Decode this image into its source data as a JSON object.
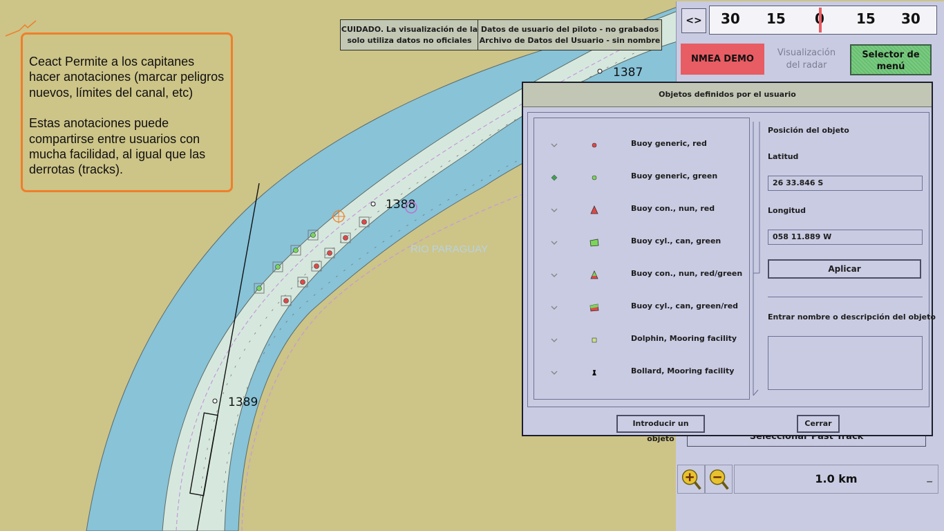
{
  "colors": {
    "land": "#cdc488",
    "deep_water": "#88c3d8",
    "shallow_water": "#d6e8de",
    "callout_border": "#ef7f2a",
    "panel_bg": "#c9cbe2",
    "nmea_bg": "#e85c63",
    "menu_bg": "#66c06f"
  },
  "callout": {
    "paragraph1": "Ceact Permite a los capitanes hacer anotaciones (marcar peligros nuevos, límites del canal, etc)",
    "paragraph2": "Estas anotaciones puede compartirse entre usuarios con mucha facilidad, al igual que las derrotas (tracks)."
  },
  "map": {
    "river_name": "RIO PARAGUAY",
    "km_markers": [
      "1387",
      "1388",
      "1389"
    ]
  },
  "warnings": {
    "caution_line1": "CUIDADO. La visualización de la",
    "caution_line2": "solo utiliza datos no oficiales",
    "pilot_line1": "Datos de usuario del piloto - no grabados",
    "pilot_line2": "Archivo de Datos del Usuario - sin nombre"
  },
  "topbar": {
    "toggle_label": "<>",
    "scale_ticks": [
      "30",
      "15",
      "0",
      "15",
      "30"
    ],
    "nmea_label": "NMEA DEMO",
    "radar_label_line1": "Visualización",
    "radar_label_line2": "del radar",
    "menu_label_line1": "Selector de",
    "menu_label_line2": "menú"
  },
  "dialog": {
    "title": "Objetos definidos por el usuario",
    "objects": [
      {
        "label": "Buoy generic, red",
        "icon": "buoy-generic-red-icon"
      },
      {
        "label": "Buoy generic, green",
        "icon": "buoy-generic-green-icon"
      },
      {
        "label": "Buoy con., nun, red",
        "icon": "buoy-conical-red-icon"
      },
      {
        "label": "Buoy cyl., can, green",
        "icon": "buoy-cylindrical-green-icon"
      },
      {
        "label": "Buoy con., nun, red/green",
        "icon": "buoy-conical-redgreen-icon"
      },
      {
        "label": "Buoy cyl., can, green/red",
        "icon": "buoy-cylindrical-greenred-icon"
      },
      {
        "label": "Dolphin, Mooring facility",
        "icon": "dolphin-icon"
      },
      {
        "label": "Bollard, Mooring facility",
        "icon": "bollard-icon"
      }
    ],
    "position_label": "Posición del objeto",
    "lat_label": "Latitud",
    "lat_value": "26 33.846 S",
    "lon_label": "Longitud",
    "lon_value": "058 11.889 W",
    "apply_label": "Aplicar",
    "desc_label": "Entrar nombre o descripción del objeto",
    "desc_value": "",
    "insert_label": "Introducir un objeto",
    "close_label": "Cerrar"
  },
  "past_track_label": "Seleccionar Past Track",
  "range": {
    "value": "1.0 km"
  }
}
